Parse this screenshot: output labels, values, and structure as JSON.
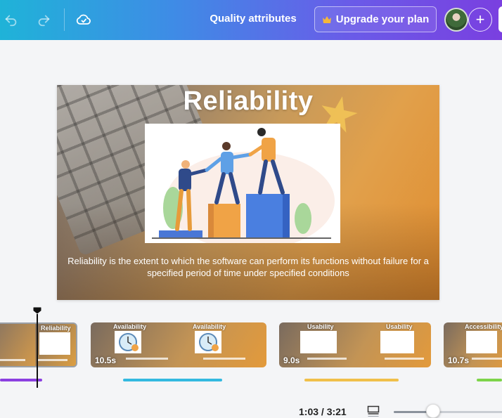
{
  "toolbar": {
    "undo_icon": "undo-icon",
    "redo_icon": "redo-icon",
    "save_status_icon": "cloud-check-icon",
    "document_title": "Quality attributes",
    "upgrade_label": "Upgrade your plan",
    "upgrade_icon": "crown-icon",
    "add_icon": "plus-icon",
    "accent": "#7a3fe0"
  },
  "slide": {
    "title": "Reliability",
    "body": "Reliability is the extent to which the software can perform its functions without failure for a specified period of time under specified conditions"
  },
  "timeline": {
    "clips": [
      {
        "name": "Reliability",
        "labels": [
          "",
          "Reliability"
        ],
        "duration": "",
        "selected": true,
        "bar_color": "#8b3fe0"
      },
      {
        "name": "Availability",
        "labels": [
          "Availability",
          "Availability"
        ],
        "duration": "10.5s",
        "selected": false,
        "bar_color": "#33b9e0"
      },
      {
        "name": "Usability",
        "labels": [
          "Usability",
          "Usability"
        ],
        "duration": "9.0s",
        "selected": false,
        "bar_color": "#f0c04a"
      },
      {
        "name": "Accessibility",
        "labels": [
          "Accessibility",
          ""
        ],
        "duration": "10.7s",
        "selected": false,
        "bar_color": "#7dd44a"
      }
    ]
  },
  "footer": {
    "timecode": "1:03 / 3:21",
    "zoom_fraction": 0.35
  }
}
